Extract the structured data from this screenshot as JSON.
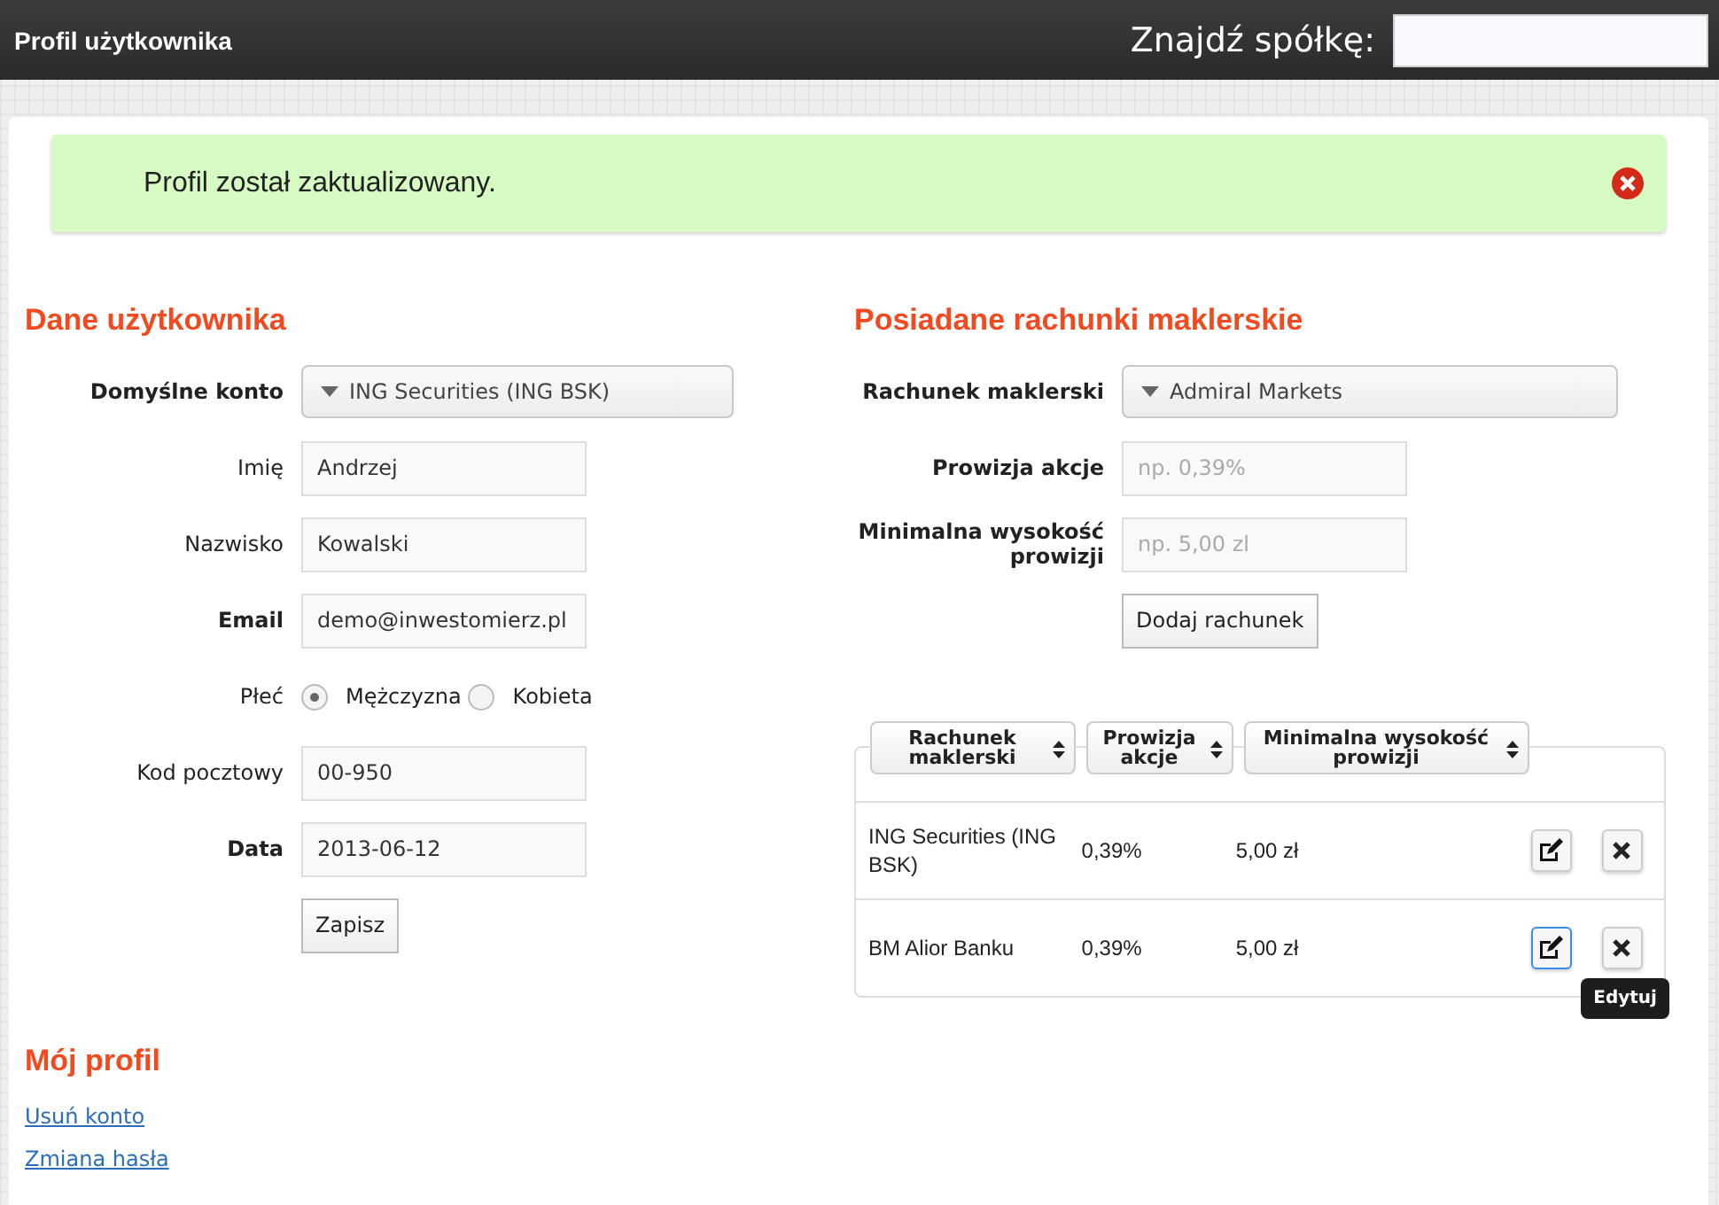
{
  "header": {
    "title": "Profil użytkownika",
    "search_label": "Znajdź spółkę:"
  },
  "alert": {
    "message": "Profil został zaktualizowany."
  },
  "user_section": {
    "title": "Dane użytkownika",
    "fields": [
      {
        "kind": "select",
        "label": "Domyślne konto",
        "emphasized": true,
        "value": "ING Securities (ING BSK)"
      },
      {
        "kind": "text",
        "label": "Imię",
        "emphasized": false,
        "value": "Andrzej"
      },
      {
        "kind": "text",
        "label": "Nazwisko",
        "emphasized": false,
        "value": "Kowalski"
      },
      {
        "kind": "text",
        "label": "Email",
        "emphasized": true,
        "value": "demo@inwestomierz.pl"
      },
      {
        "kind": "radio",
        "label": "Płeć",
        "emphasized": false,
        "options": [
          {
            "label": "Mężczyzna",
            "selected": true
          },
          {
            "label": "Kobieta",
            "selected": false
          }
        ]
      },
      {
        "kind": "text",
        "label": "Kod pocztowy",
        "emphasized": false,
        "value": "00-950"
      },
      {
        "kind": "text",
        "label": "Data",
        "emphasized": true,
        "value": "2013-06-12"
      }
    ],
    "submit": "Zapisz"
  },
  "accounts_section": {
    "title": "Posiadane rachunki maklerskie",
    "fields": [
      {
        "kind": "select",
        "label": "Rachunek maklerski",
        "value": "Admiral Markets"
      },
      {
        "kind": "text",
        "label": "Prowizja akcje",
        "placeholder": "np. 0,39%"
      },
      {
        "kind": "text",
        "label": "Minimalna wysokość prowizji",
        "placeholder": "np. 5,00 zl"
      }
    ],
    "add_button": "Dodaj rachunek",
    "table": {
      "columns": [
        "Rachunek maklerski",
        "Prowizja akcje",
        "Minimalna wysokość prowizji"
      ],
      "rows": [
        {
          "cells": [
            "ING Securities (ING BSK)",
            "0,39%",
            "5,00 zł"
          ],
          "edit_focused": false
        },
        {
          "cells": [
            "BM Alior Banku",
            "0,39%",
            "5,00 zł"
          ],
          "edit_focused": true,
          "tooltip": "Edytuj"
        }
      ]
    }
  },
  "profile_section": {
    "title": "Mój profil",
    "links": [
      "Usuń konto",
      "Zmiana hasła"
    ]
  }
}
